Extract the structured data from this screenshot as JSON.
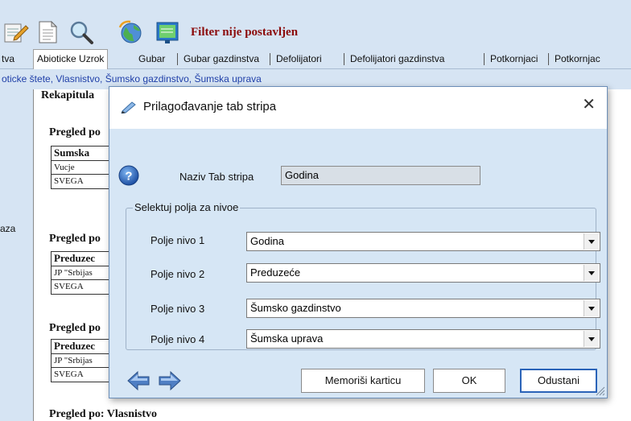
{
  "toolbar": {
    "icons": [
      "edit-document-icon",
      "document-icon",
      "search-icon",
      "globe-icon",
      "presentation-icon"
    ],
    "filter_status": "Filter nije postavljen",
    "filter_color": "#8b0a0a"
  },
  "tabs": [
    {
      "label": "tva",
      "active": false
    },
    {
      "label": "Abioticke Uzrok",
      "active": true
    },
    {
      "label": "Gubar",
      "active": false
    },
    {
      "label": "Gubar gazdinstva",
      "active": false
    },
    {
      "label": "Defolijatori",
      "active": false
    },
    {
      "label": "Defolijatori gazdinstva",
      "active": false
    },
    {
      "label": "Potkornjaci",
      "active": false
    },
    {
      "label": "Potkornjac",
      "active": false
    }
  ],
  "breadcrumb": "oticke štete, Vlasnistvo, Šumsko gazdinstvo, Šumska uprava",
  "left_strip_label": "aza",
  "report": {
    "heading": "Rekapitula",
    "sections": [
      {
        "title": "Pregled po",
        "header": "Sumska",
        "rows": [
          "Vucje",
          "SVEGA"
        ]
      },
      {
        "title": "Pregled po",
        "header": "Preduzec",
        "rows": [
          "JP \"Srbijas",
          "SVEGA"
        ]
      },
      {
        "title": "Pregled po",
        "header": "Preduzec",
        "rows": [
          "JP \"Srbijas",
          "SVEGA"
        ]
      }
    ],
    "footer_title": "Pregled po: Vlasnistvo"
  },
  "dialog": {
    "title": "Prilagođavanje tab stripa",
    "name_label": "Naziv Tab stripa",
    "name_value": "Godina",
    "group_title": "Selektuj polja za nivoe",
    "levels": [
      {
        "label": "Polje nivo 1",
        "value": "Godina"
      },
      {
        "label": "Polje nivo 2",
        "value": "Preduzeće"
      },
      {
        "label": "Polje nivo 3",
        "value": "Šumsko gazdinstvo"
      },
      {
        "label": "Polje nivo 4",
        "value": "Šumska uprava"
      }
    ],
    "save_label": "Memoriši karticu",
    "ok_label": "OK",
    "cancel_label": "Odustani"
  }
}
